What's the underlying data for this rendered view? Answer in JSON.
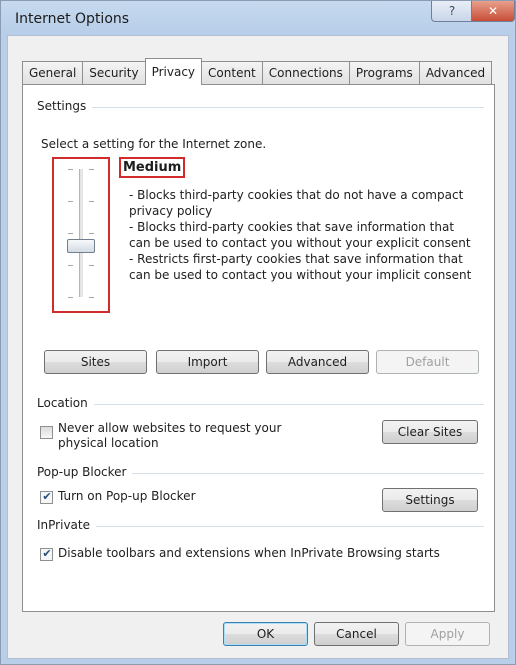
{
  "window": {
    "title": "Internet Options",
    "help_glyph": "?",
    "close_glyph": "✕"
  },
  "tabs": [
    {
      "label": "General"
    },
    {
      "label": "Security"
    },
    {
      "label": "Privacy",
      "active": true
    },
    {
      "label": "Content"
    },
    {
      "label": "Connections"
    },
    {
      "label": "Programs"
    },
    {
      "label": "Advanced"
    }
  ],
  "settings": {
    "group_label": "Settings",
    "zone_text": "Select a setting for the Internet zone.",
    "level": "Medium",
    "description": [
      "- Blocks third-party cookies that do not have a compact privacy policy",
      "- Blocks third-party cookies that save information that can be used to contact you without your explicit consent",
      "- Restricts first-party cookies that save information that can be used to contact you without your implicit consent"
    ],
    "buttons": {
      "sites": "Sites",
      "import": "Import",
      "advanced": "Advanced",
      "default": "Default"
    }
  },
  "location": {
    "group_label": "Location",
    "checkbox_label": "Never allow websites to request your physical location",
    "checked": false,
    "clear_sites": "Clear Sites"
  },
  "popup_blocker": {
    "group_label": "Pop-up Blocker",
    "checkbox_label": "Turn on Pop-up Blocker",
    "checked": true,
    "settings": "Settings"
  },
  "inprivate": {
    "group_label": "InPrivate",
    "checkbox_label": "Disable toolbars and extensions when InPrivate Browsing starts",
    "checked": true
  },
  "footer": {
    "ok": "OK",
    "cancel": "Cancel",
    "apply": "Apply"
  },
  "colors": {
    "highlight_box": "#d12b2b",
    "check_mark": "#2a4a7a"
  }
}
